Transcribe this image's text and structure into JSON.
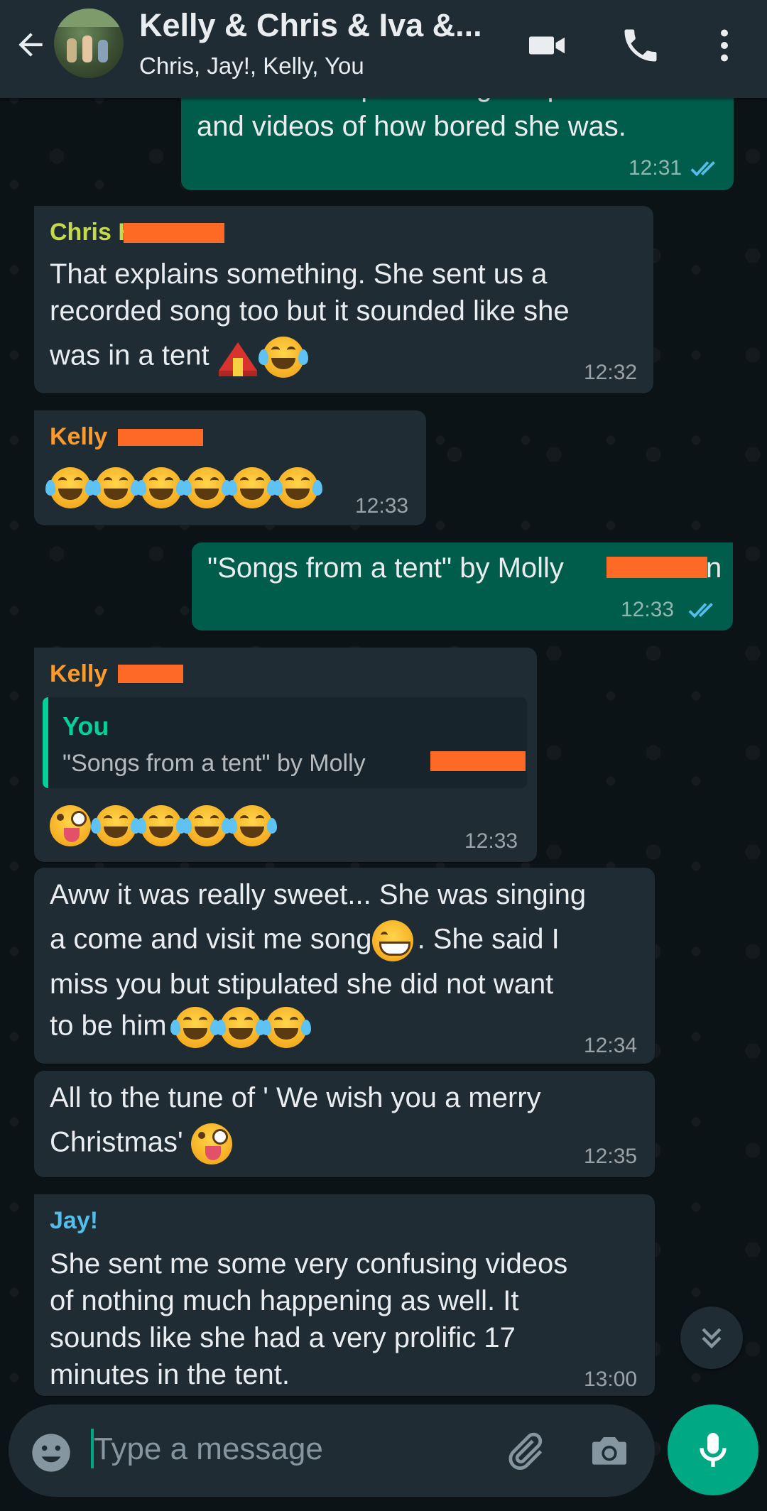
{
  "header": {
    "title": "Kelly & Chris & Iva &...",
    "subtitle": "Chris, Jay!, Kelly, You"
  },
  "messages": [
    {
      "direction": "out",
      "lines": [
        "which she kept sending me photos",
        "and videos of how bored she was."
      ],
      "time": "12:31",
      "status": "read"
    },
    {
      "direction": "in",
      "sender": "Chris H",
      "sender_color": "#c4d94b",
      "lines": [
        "That explains something. She sent us a",
        "recorded song too but it sounded like she",
        "was in a tent"
      ],
      "emojis": [
        "circus-tent",
        "face-with-tears-of-joy"
      ],
      "time": "12:32"
    },
    {
      "direction": "in",
      "sender": "Kelly",
      "sender_color": "#fc9b2c",
      "emojis": [
        "face-with-tears-of-joy",
        "face-with-tears-of-joy",
        "face-with-tears-of-joy",
        "face-with-tears-of-joy",
        "face-with-tears-of-joy",
        "face-with-tears-of-joy"
      ],
      "time": "12:33"
    },
    {
      "direction": "out",
      "lines": [
        "\"Songs from a tent\" by Molly"
      ],
      "trailing": "n",
      "time": "12:33",
      "status": "read"
    },
    {
      "direction": "in",
      "sender": "Kelly",
      "sender_color": "#fc9b2c",
      "quote": {
        "author": "You",
        "text": "\"Songs from a tent\" by Molly"
      },
      "emojis": [
        "zany-face",
        "face-with-tears-of-joy",
        "face-with-tears-of-joy",
        "face-with-tears-of-joy",
        "face-with-tears-of-joy"
      ],
      "time": "12:33"
    },
    {
      "direction": "in",
      "lines": [
        "Aww it was really sweet... She was singing",
        "a come and visit me song",
        ". She said I",
        "miss you but stipulated she did not want",
        "to be him"
      ],
      "time": "12:34"
    },
    {
      "direction": "in",
      "lines": [
        "All to the tune of ' We wish you a merry",
        "Christmas'"
      ],
      "time": "12:35"
    },
    {
      "direction": "in",
      "sender": "Jay!",
      "sender_color": "#53bdeb",
      "lines": [
        "She sent me some very confusing videos",
        "of nothing much happening as well. It",
        "sounds like she had a very prolific 17",
        "minutes in the tent."
      ],
      "time": "13:00"
    }
  ],
  "composer": {
    "placeholder": "Type a message"
  },
  "icons": {
    "back": "arrow-left-icon",
    "video": "video-call-icon",
    "call": "phone-icon",
    "menu": "more-vert-icon",
    "emoji": "emoji-icon",
    "attach": "paperclip-icon",
    "camera": "camera-icon",
    "mic": "microphone-icon",
    "scroll": "double-chevron-down-icon"
  },
  "colors": {
    "header_bg": "#1f2c34",
    "incoming_bubble": "#1f2c34",
    "outgoing_bubble": "#005c4b",
    "accent": "#00a884",
    "read_ticks": "#53bdeb",
    "redaction": "#fe6a26"
  }
}
